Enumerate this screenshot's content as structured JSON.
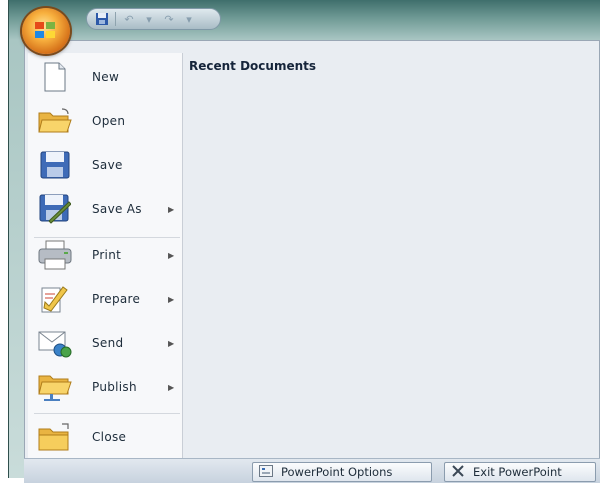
{
  "quick_access": {
    "icons": [
      "save-icon",
      "undo-icon",
      "redo-icon",
      "customize-dropdown-icon"
    ]
  },
  "office_button": {
    "icon": "office-logo-icon"
  },
  "menu": {
    "items": [
      {
        "label": "New",
        "icon": "new-document-icon",
        "has_submenu": false
      },
      {
        "label": "Open",
        "icon": "open-folder-icon",
        "has_submenu": false
      },
      {
        "label": "Save",
        "icon": "save-icon",
        "has_submenu": false
      },
      {
        "label": "Save As",
        "icon": "save-as-icon",
        "has_submenu": true
      },
      {
        "label": "Print",
        "icon": "printer-icon",
        "has_submenu": true
      },
      {
        "label": "Prepare",
        "icon": "prepare-icon",
        "has_submenu": true
      },
      {
        "label": "Send",
        "icon": "send-icon",
        "has_submenu": true
      },
      {
        "label": "Publish",
        "icon": "publish-icon",
        "has_submenu": true
      },
      {
        "label": "Close",
        "icon": "close-folder-icon",
        "has_submenu": false
      }
    ]
  },
  "recent": {
    "title": "Recent Documents"
  },
  "bottom": {
    "options_label": "PowerPoint Options",
    "exit_label": "Exit PowerPoint"
  }
}
